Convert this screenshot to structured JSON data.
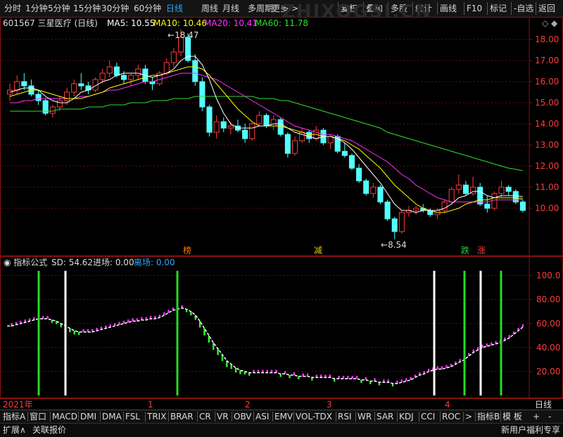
{
  "toolbar": {
    "periods": [
      "分时",
      "1分钟",
      "5分钟",
      "15分钟",
      "30分钟",
      "60分钟",
      "日线",
      "周线",
      "月线",
      "多周期",
      "更多 >"
    ],
    "active_index": 6,
    "right_buttons": [
      "复权",
      "叠加",
      "多股",
      "统计",
      "画线",
      "F10",
      "标记",
      "-自选",
      "返回"
    ]
  },
  "stock": {
    "header": "601567 三星医疗 (日线)",
    "ma5_label": "MA5: 10.55",
    "ma10_label": "MA10: 10.46",
    "ma20_label": "MA20: 10.41",
    "ma60_label": "MA60: 11.78",
    "high_label": "18.47",
    "low_label": "8.54",
    "watermark": "ZHIXOGSI.CN",
    "markers": [
      {
        "text": "榜",
        "color": "#ff7a00"
      },
      {
        "text": "减",
        "color": "#e8c800"
      },
      {
        "text": "跌",
        "color": "#2ecc40"
      },
      {
        "text": "涨",
        "color": "#ff3b3b"
      }
    ]
  },
  "price_axis": [
    "18.00",
    "17.00",
    "16.00",
    "15.00",
    "14.00",
    "13.00",
    "12.00",
    "11.00",
    "10.00"
  ],
  "indicator": {
    "title": "指标公式",
    "sd_label": "SD: 54.62",
    "entry_label": "进场: 0.00",
    "exit_label": "离场: 0.00",
    "axis": [
      "100.0",
      "80.00",
      "60.00",
      "40.00",
      "20.00"
    ]
  },
  "chart_data": {
    "type": "line",
    "title": "601567 三星医疗 (日线)",
    "price_ylim": [
      8.0,
      18.8
    ],
    "series": [
      {
        "name": "MA5",
        "color": "#ffffff",
        "last": 10.55
      },
      {
        "name": "MA10",
        "color": "#ffff00",
        "last": 10.46
      },
      {
        "name": "MA20",
        "color": "#ff33ff",
        "last": 10.41
      },
      {
        "name": "MA60",
        "color": "#33dd33",
        "last": 11.78
      }
    ],
    "ohlc": [
      [
        15.4,
        15.9,
        15.1,
        15.6
      ],
      [
        15.6,
        16.3,
        15.4,
        16.0
      ],
      [
        16.0,
        16.4,
        15.6,
        15.8
      ],
      [
        15.8,
        16.1,
        15.3,
        15.4
      ],
      [
        15.4,
        15.6,
        14.9,
        15.1
      ],
      [
        15.1,
        15.2,
        14.4,
        14.5
      ],
      [
        14.5,
        14.9,
        14.3,
        14.8
      ],
      [
        14.8,
        15.3,
        14.6,
        15.1
      ],
      [
        15.1,
        15.7,
        14.9,
        15.5
      ],
      [
        15.5,
        16.1,
        15.3,
        15.9
      ],
      [
        15.9,
        16.4,
        15.6,
        15.8
      ],
      [
        15.8,
        16.0,
        15.4,
        15.6
      ],
      [
        15.6,
        16.2,
        15.5,
        16.1
      ],
      [
        16.1,
        16.6,
        15.9,
        16.4
      ],
      [
        16.4,
        17.0,
        16.2,
        16.7
      ],
      [
        16.7,
        16.9,
        16.2,
        16.3
      ],
      [
        16.3,
        16.5,
        15.9,
        16.1
      ],
      [
        16.1,
        16.4,
        15.8,
        16.3
      ],
      [
        16.3,
        16.8,
        16.1,
        16.6
      ],
      [
        16.6,
        16.8,
        15.9,
        16.0
      ],
      [
        16.0,
        16.2,
        15.6,
        15.9
      ],
      [
        15.9,
        16.5,
        15.8,
        16.4
      ],
      [
        16.4,
        17.1,
        16.3,
        16.9
      ],
      [
        16.9,
        17.6,
        16.7,
        17.4
      ],
      [
        17.4,
        18.47,
        17.2,
        18.1
      ],
      [
        18.1,
        18.3,
        16.9,
        17.0
      ],
      [
        17.0,
        17.3,
        15.8,
        16.0
      ],
      [
        16.0,
        16.2,
        14.6,
        14.8
      ],
      [
        14.8,
        14.9,
        13.4,
        13.6
      ],
      [
        13.6,
        14.4,
        13.3,
        14.1
      ],
      [
        14.1,
        14.3,
        13.6,
        13.8
      ],
      [
        13.8,
        14.1,
        13.5,
        13.9
      ],
      [
        13.9,
        14.2,
        13.6,
        13.7
      ],
      [
        13.7,
        14.0,
        13.1,
        13.3
      ],
      [
        13.3,
        14.1,
        13.2,
        14.0
      ],
      [
        14.0,
        14.6,
        13.9,
        14.4
      ],
      [
        14.4,
        14.5,
        13.8,
        13.9
      ],
      [
        13.9,
        14.4,
        13.7,
        14.2
      ],
      [
        14.2,
        14.3,
        13.4,
        13.5
      ],
      [
        13.5,
        13.6,
        12.4,
        12.6
      ],
      [
        12.6,
        13.4,
        12.5,
        13.2
      ],
      [
        13.2,
        13.8,
        13.1,
        13.6
      ],
      [
        13.6,
        13.7,
        13.1,
        13.3
      ],
      [
        13.3,
        13.9,
        13.2,
        13.7
      ],
      [
        13.7,
        13.8,
        13.0,
        13.1
      ],
      [
        13.1,
        13.5,
        12.8,
        13.4
      ],
      [
        13.4,
        13.5,
        12.6,
        12.7
      ],
      [
        12.7,
        13.1,
        12.4,
        12.5
      ],
      [
        12.5,
        12.6,
        11.8,
        11.9
      ],
      [
        11.9,
        12.1,
        11.2,
        11.3
      ],
      [
        11.3,
        11.4,
        10.6,
        10.7
      ],
      [
        10.7,
        11.2,
        10.5,
        11.0
      ],
      [
        11.0,
        11.1,
        10.2,
        10.3
      ],
      [
        10.3,
        10.4,
        9.4,
        9.5
      ],
      [
        9.5,
        9.6,
        8.54,
        8.9
      ],
      [
        8.9,
        9.9,
        8.8,
        9.8
      ],
      [
        9.8,
        10.1,
        9.6,
        9.9
      ],
      [
        9.9,
        10.1,
        9.7,
        10.0
      ],
      [
        10.0,
        10.2,
        9.8,
        9.9
      ],
      [
        9.9,
        10.0,
        9.6,
        9.7
      ],
      [
        9.7,
        10.0,
        9.5,
        9.9
      ],
      [
        9.9,
        10.4,
        9.8,
        10.3
      ],
      [
        10.3,
        11.0,
        10.2,
        10.9
      ],
      [
        10.9,
        11.6,
        10.7,
        11.1
      ],
      [
        11.1,
        11.3,
        10.6,
        10.7
      ],
      [
        10.7,
        11.5,
        10.6,
        11.0
      ],
      [
        11.0,
        11.2,
        10.1,
        10.2
      ],
      [
        10.2,
        10.6,
        9.8,
        10.0
      ],
      [
        10.0,
        10.8,
        9.9,
        10.7
      ],
      [
        10.7,
        11.3,
        10.5,
        11.0
      ],
      [
        11.0,
        11.1,
        10.6,
        10.8
      ],
      [
        10.8,
        10.9,
        10.2,
        10.3
      ],
      [
        10.3,
        10.4,
        9.8,
        9.9
      ]
    ],
    "ma5": [
      15.5,
      15.6,
      15.7,
      15.7,
      15.6,
      15.3,
      15.1,
      15.0,
      15.0,
      15.2,
      15.5,
      15.6,
      15.8,
      16.0,
      16.1,
      16.3,
      16.4,
      16.4,
      16.4,
      16.3,
      16.2,
      16.3,
      16.4,
      16.6,
      17.0,
      17.2,
      17.2,
      16.8,
      16.1,
      15.2,
      14.5,
      14.0,
      13.8,
      13.8,
      13.8,
      13.9,
      13.9,
      14.0,
      14.0,
      13.8,
      13.6,
      13.5,
      13.4,
      13.3,
      13.4,
      13.4,
      13.3,
      13.1,
      12.8,
      12.4,
      12.0,
      11.6,
      11.2,
      10.7,
      10.2,
      9.9,
      9.9,
      9.8,
      9.9,
      9.9,
      9.9,
      10.0,
      10.2,
      10.5,
      10.6,
      10.8,
      10.8,
      10.6,
      10.5,
      10.6,
      10.6,
      10.6,
      10.55
    ],
    "ma10": [
      15.3,
      15.4,
      15.5,
      15.6,
      15.6,
      15.5,
      15.4,
      15.3,
      15.2,
      15.2,
      15.2,
      15.3,
      15.4,
      15.5,
      15.7,
      15.8,
      15.9,
      16.0,
      16.1,
      16.2,
      16.3,
      16.3,
      16.4,
      16.5,
      16.6,
      16.7,
      16.7,
      16.6,
      16.3,
      15.9,
      15.5,
      15.1,
      14.7,
      14.4,
      14.1,
      13.9,
      13.9,
      13.9,
      13.9,
      13.8,
      13.7,
      13.6,
      13.5,
      13.5,
      13.4,
      13.4,
      13.3,
      13.2,
      13.0,
      12.8,
      12.5,
      12.2,
      11.9,
      11.5,
      11.1,
      10.8,
      10.5,
      10.2,
      10.0,
      9.9,
      9.8,
      9.8,
      9.9,
      10.0,
      10.2,
      10.3,
      10.4,
      10.4,
      10.5,
      10.5,
      10.5,
      10.5,
      10.46
    ],
    "ma20": [
      15.0,
      15.0,
      15.1,
      15.1,
      15.2,
      15.2,
      15.2,
      15.2,
      15.2,
      15.2,
      15.3,
      15.3,
      15.4,
      15.5,
      15.6,
      15.6,
      15.7,
      15.8,
      15.9,
      16.0,
      16.0,
      16.1,
      16.2,
      16.3,
      16.4,
      16.4,
      16.4,
      16.3,
      16.2,
      16.1,
      15.9,
      15.7,
      15.5,
      15.3,
      15.1,
      14.9,
      14.7,
      14.5,
      14.3,
      14.1,
      13.9,
      13.8,
      13.7,
      13.6,
      13.5,
      13.5,
      13.4,
      13.3,
      13.2,
      13.0,
      12.8,
      12.6,
      12.4,
      12.2,
      11.9,
      11.6,
      11.4,
      11.1,
      10.9,
      10.7,
      10.5,
      10.4,
      10.3,
      10.3,
      10.3,
      10.3,
      10.3,
      10.3,
      10.4,
      10.4,
      10.4,
      10.4,
      10.41
    ],
    "ma60": [
      14.6,
      14.6,
      14.6,
      14.6,
      14.6,
      14.6,
      14.6,
      14.7,
      14.7,
      14.7,
      14.7,
      14.8,
      14.8,
      14.8,
      14.9,
      14.9,
      14.9,
      15.0,
      15.0,
      15.0,
      15.1,
      15.1,
      15.1,
      15.2,
      15.2,
      15.2,
      15.3,
      15.3,
      15.3,
      15.3,
      15.3,
      15.3,
      15.3,
      15.3,
      15.3,
      15.2,
      15.2,
      15.2,
      15.1,
      15.1,
      15.0,
      14.9,
      14.8,
      14.7,
      14.6,
      14.5,
      14.4,
      14.3,
      14.2,
      14.1,
      14.0,
      13.9,
      13.8,
      13.6,
      13.5,
      13.4,
      13.3,
      13.2,
      13.1,
      13.0,
      12.9,
      12.8,
      12.7,
      12.6,
      12.5,
      12.4,
      12.3,
      12.2,
      12.1,
      12.0,
      11.9,
      11.85,
      11.78
    ],
    "indicator_ylim": [
      0,
      108
    ],
    "indicator_line": [
      58,
      58,
      59,
      60,
      61,
      62,
      63,
      64,
      64,
      64,
      63,
      62,
      60,
      58,
      56,
      54,
      53,
      53,
      53,
      53,
      54,
      55,
      56,
      57,
      58,
      59,
      60,
      61,
      62,
      62,
      63,
      63,
      64,
      64,
      65,
      67,
      69,
      71,
      72,
      73,
      72,
      70,
      67,
      62,
      56,
      50,
      44,
      39,
      34,
      29,
      26,
      23,
      21,
      20,
      19,
      19,
      19,
      19,
      19,
      19,
      19,
      18,
      18,
      17,
      17,
      16,
      16,
      16,
      15,
      15,
      15,
      15,
      15,
      14,
      14,
      14,
      14,
      14,
      14,
      13,
      13,
      12,
      12,
      11,
      11,
      11,
      10,
      10,
      11,
      12,
      13,
      15,
      17,
      18,
      20,
      21,
      22,
      22,
      23,
      24,
      26,
      28,
      30,
      33,
      36,
      38,
      40,
      41,
      42,
      43,
      44,
      46,
      48,
      51,
      54,
      57
    ],
    "entry_signals": [
      19,
      84
    ],
    "exit_signals": [
      31,
      82,
      89
    ]
  },
  "dates": [
    "2021年",
    "1",
    "2",
    "3",
    "4",
    "日线"
  ],
  "tabs": [
    "指标A",
    "窗口",
    "MACD",
    "DMI",
    "DMA",
    "FSL",
    "TRIX",
    "BRAR",
    "CR",
    "VR",
    "OBV",
    "ASI",
    "EMV",
    "VOL-TDX",
    "RSI",
    "WR",
    "SAR",
    "KDJ",
    "CCI",
    "ROC",
    ">",
    "指标B",
    "模 板"
  ],
  "bottom": {
    "expand": "扩展∧",
    "quote": "关联报价",
    "promo": "新用户福利专享"
  }
}
